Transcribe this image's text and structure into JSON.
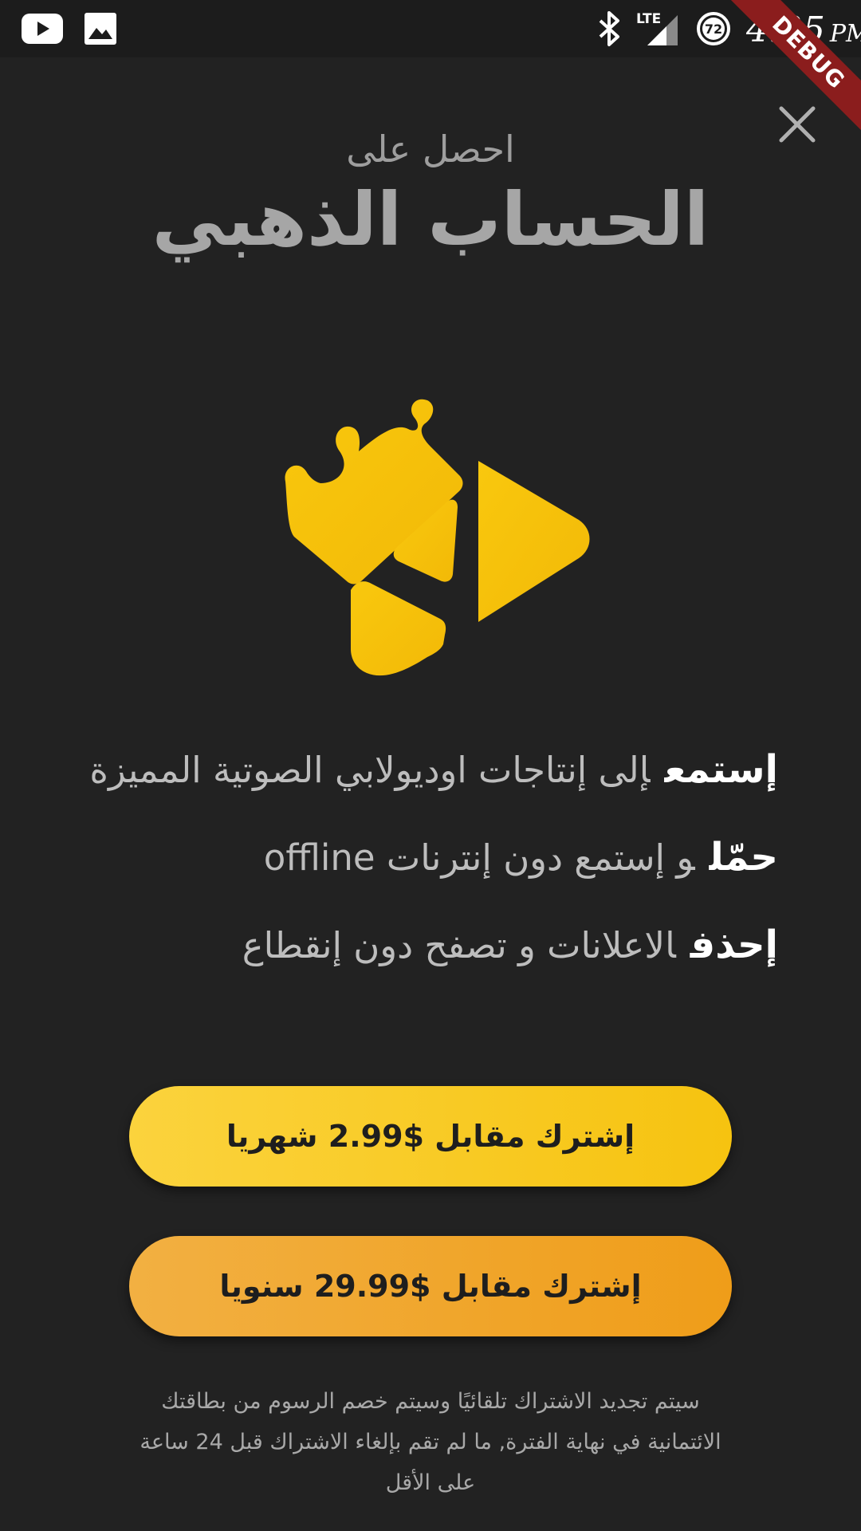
{
  "status_bar": {
    "time": "4:25",
    "ampm": "PM",
    "network": "LTE",
    "battery_level": "72",
    "icons": [
      "youtube-icon",
      "gallery-icon",
      "bluetooth-icon",
      "signal-icon",
      "battery-icon"
    ]
  },
  "debug_banner": "DEBUG",
  "header": {
    "subtitle": "احصل على",
    "title": "الحساب الذهبي"
  },
  "logo": {
    "icon": "crown-play-logo-icon",
    "color": "#f5c20c"
  },
  "features": [
    {
      "verb": "إستمع",
      "text": "إلى إنتاجات اوديولابي الصوتية المميزة"
    },
    {
      "verb": "حمّل",
      "text": "و إستمع دون إنترنات offline"
    },
    {
      "verb": "إحذف",
      "text": "الاعلانات و تصفح دون إنقطاع"
    }
  ],
  "buttons": {
    "monthly_label": "إشترك مقابل $2.99 شهريا",
    "yearly_label": "إشترك مقابل $29.99 سنويا"
  },
  "footer": {
    "line1": "سيتم تجديد الاشتراك تلقائيًا وسيتم خصم الرسوم من بطاقتك",
    "line2": "الائتمانية في نهاية الفترة, ما لم تقم بإلغاء الاشتراك قبل 24 ساعة",
    "line3": "على الأقل"
  },
  "colors": {
    "background": "#222222",
    "accent_gold": "#f5c20c",
    "monthly_button": "#f8c823",
    "yearly_button": "#f0a72c"
  }
}
